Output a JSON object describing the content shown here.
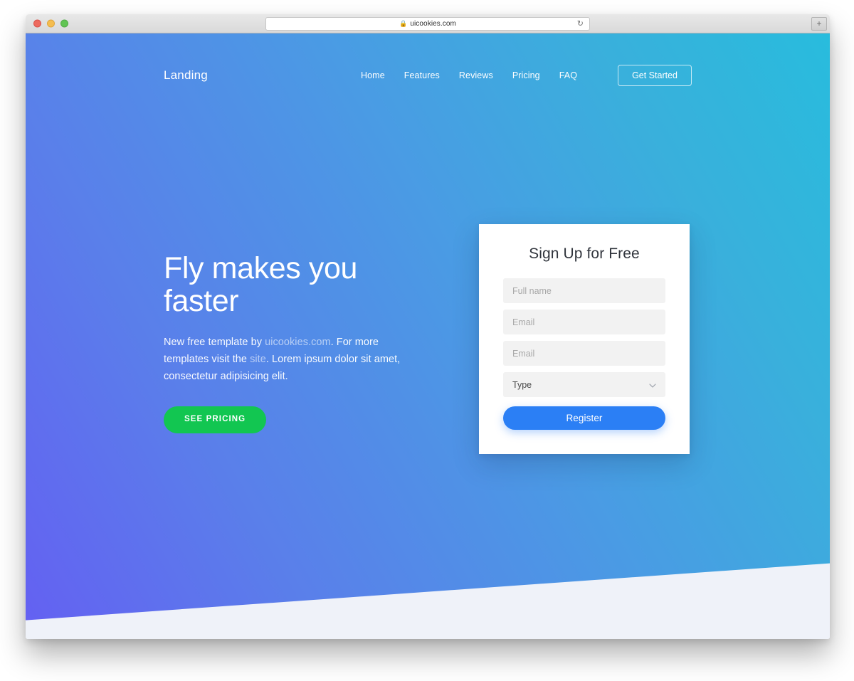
{
  "browser": {
    "url": "uicookies.com",
    "lock_icon": "lock-icon",
    "reload_icon": "reload-icon",
    "new_tab_label": "+",
    "traffic_lights": [
      "close",
      "minimize",
      "maximize"
    ]
  },
  "nav": {
    "brand": "Landing",
    "links": [
      {
        "label": "Home"
      },
      {
        "label": "Features"
      },
      {
        "label": "Reviews"
      },
      {
        "label": "Pricing"
      },
      {
        "label": "FAQ"
      }
    ],
    "cta_label": "Get Started"
  },
  "hero": {
    "title": "Fly makes you faster",
    "paragraph": {
      "part1": "New free template by ",
      "link1": "uicookies.com",
      "part2": ". For more templates visit the ",
      "link2": "site",
      "part3": ". Lorem ipsum dolor sit amet, consectetur adipisicing elit."
    },
    "pricing_button": "SEE PRICING"
  },
  "signup": {
    "title": "Sign Up for Free",
    "fields": [
      {
        "name": "full-name",
        "placeholder": "Full name",
        "value": ""
      },
      {
        "name": "email",
        "placeholder": "Email",
        "value": ""
      },
      {
        "name": "email-confirm",
        "placeholder": "Email",
        "value": ""
      }
    ],
    "select": {
      "placeholder": "Type",
      "value": "Type",
      "icon": "chevron-down-icon"
    },
    "submit_label": "Register"
  },
  "colors": {
    "gradient_start": "#6460f2",
    "gradient_mid": "#4a9be4",
    "gradient_end": "#28bcdd",
    "accent_green": "#12c651",
    "accent_blue": "#2b7ff5",
    "page_bottom": "#eff2f9",
    "card_bg": "#ffffff",
    "field_bg": "#f2f2f2"
  }
}
